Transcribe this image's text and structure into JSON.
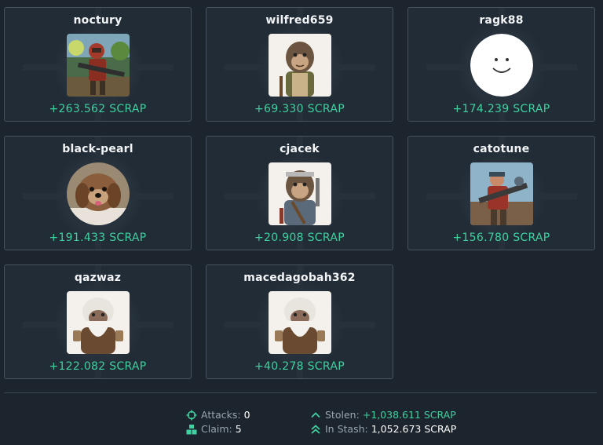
{
  "cards": [
    {
      "name": "noctury",
      "amount": "+263.562 SCRAP",
      "avatar": "soldier-avatar"
    },
    {
      "name": "wilfred659",
      "amount": "+69.330 SCRAP",
      "avatar": "monkey-avatar"
    },
    {
      "name": "ragk88",
      "amount": "+174.239 SCRAP",
      "avatar": "smiley-avatar"
    },
    {
      "name": "black-pearl",
      "amount": "+191.433 SCRAP",
      "avatar": "dog-avatar"
    },
    {
      "name": "cjacek",
      "amount": "+20.908 SCRAP",
      "avatar": "monkey-avatar"
    },
    {
      "name": "catotune",
      "amount": "+156.780 SCRAP",
      "avatar": "soldier-avatar"
    },
    {
      "name": "qazwaz",
      "amount": "+122.082 SCRAP",
      "avatar": "dwarf-avatar"
    },
    {
      "name": "macedagobah362",
      "amount": "+40.278 SCRAP",
      "avatar": "dwarf-avatar"
    }
  ],
  "stats": {
    "attacks_label": "Attacks:",
    "attacks_value": "0",
    "claim_label": "Claim:",
    "claim_value": "5",
    "stolen_label": "Stolen:",
    "stolen_value": "+1,038.611 SCRAP",
    "stash_label": "In Stash:",
    "stash_value": "1,052.673 SCRAP"
  },
  "colors": {
    "accent": "#3fd1a0",
    "background": "#1c242d",
    "card_border": "#46525d"
  }
}
